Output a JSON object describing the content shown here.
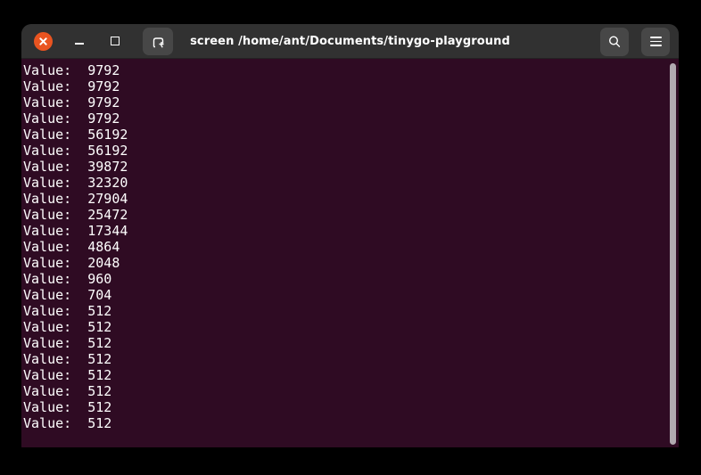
{
  "window": {
    "title": "screen /home/ant/Documents/tinygo-playground",
    "controls": {
      "close": "close-window",
      "minimize": "minimize-window",
      "maximize": "maximize-window",
      "new_tab": "new-tab",
      "search": "search",
      "menu": "menu"
    }
  },
  "terminal": {
    "label": "Value:",
    "separator": "  ",
    "values": [
      "9792",
      "9792",
      "9792",
      "9792",
      "56192",
      "56192",
      "39872",
      "32320",
      "27904",
      "25472",
      "17344",
      "4864",
      "2048",
      "960",
      "704",
      "512",
      "512",
      "512",
      "512",
      "512",
      "512",
      "512",
      "512"
    ]
  },
  "colors": {
    "close-bg": "#e95420",
    "window-bg": "#313131",
    "button-bg": "#474747",
    "term-bg": "#2f0b23",
    "term-fg": "#ffffff",
    "scrollbar": "#b1a9b0"
  }
}
